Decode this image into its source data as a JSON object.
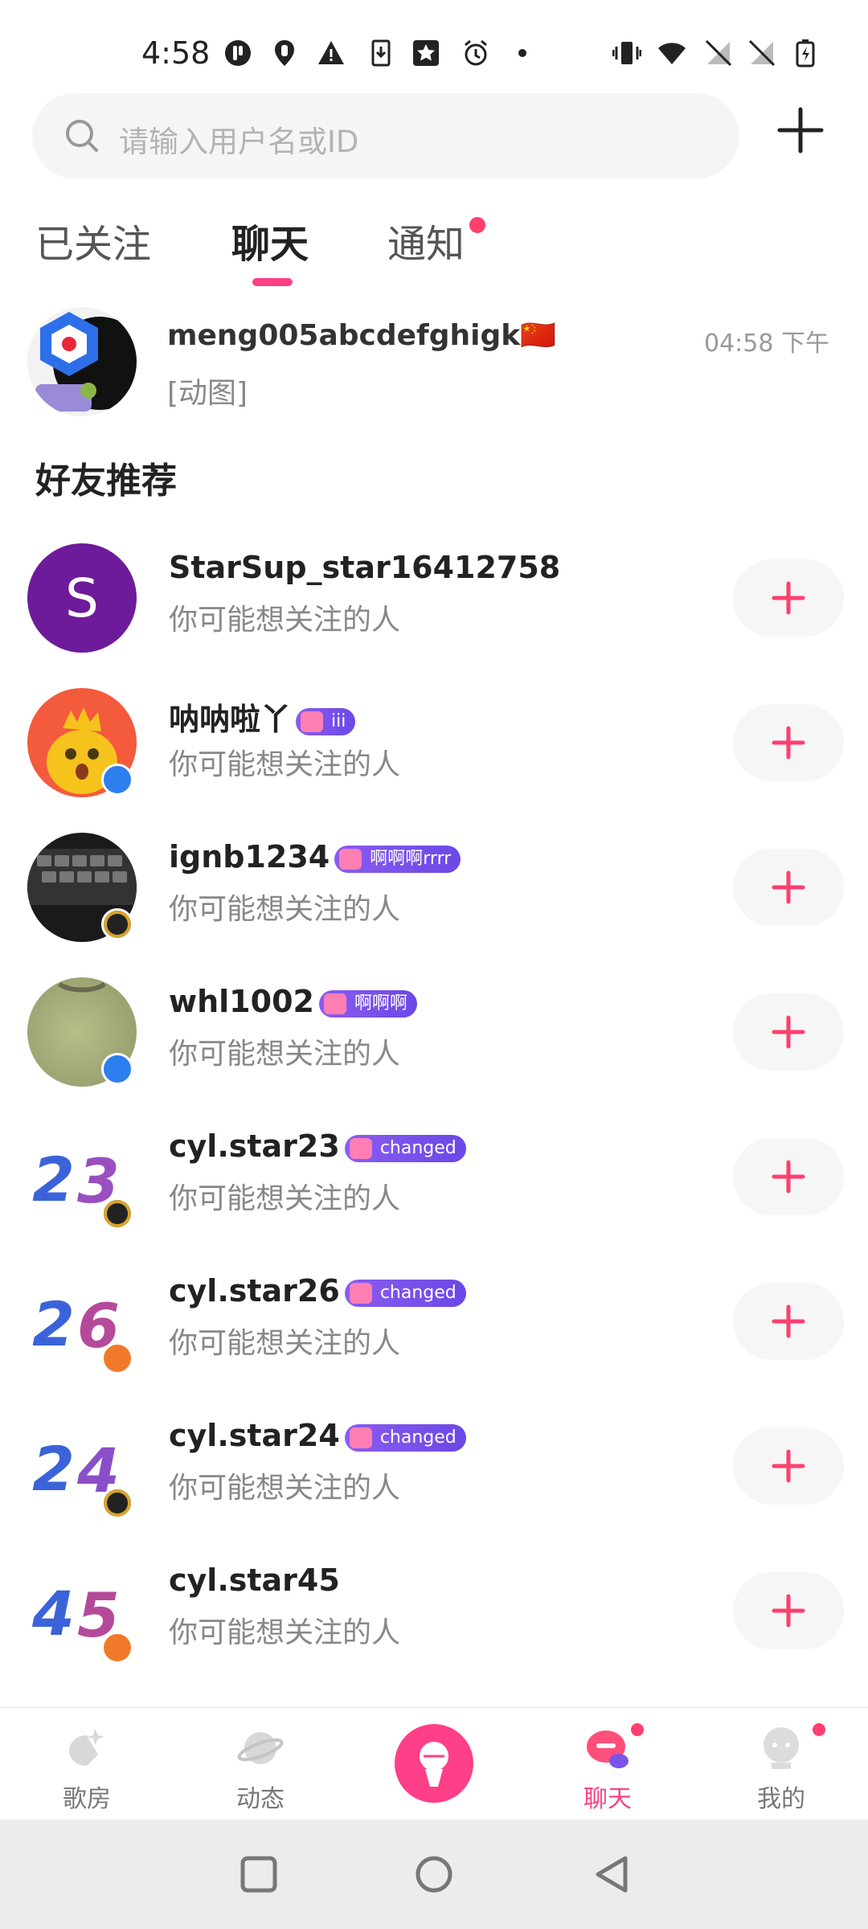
{
  "status_bar": {
    "time": "4:58"
  },
  "search": {
    "placeholder": "请输入用户名或ID"
  },
  "tabs": [
    {
      "label": "已关注"
    },
    {
      "label": "聊天"
    },
    {
      "label": "通知"
    }
  ],
  "chat": {
    "name": "meng005abcdefghigk🇨🇳",
    "last_message": "[动图]",
    "time": "04:58 下午"
  },
  "section_title": "好友推荐",
  "recommend": {
    "subtitle": "你可能想关注的人",
    "items": [
      {
        "name": "StarSup_star16412758",
        "tag": ""
      },
      {
        "name": "呐呐啦丫",
        "tag": "iii"
      },
      {
        "name": "ignb1234",
        "tag": "啊啊啊rrrr"
      },
      {
        "name": "whl1002",
        "tag": "啊啊啊"
      },
      {
        "name": "cyl.star23",
        "tag": "changed"
      },
      {
        "name": "cyl.star26",
        "tag": "changed"
      },
      {
        "name": "cyl.star24",
        "tag": "changed"
      },
      {
        "name": "cyl.star45",
        "tag": ""
      }
    ],
    "avatar_letter": "S"
  },
  "bottom_nav": [
    {
      "label": "歌房"
    },
    {
      "label": "动态"
    },
    {
      "label": ""
    },
    {
      "label": "聊天"
    },
    {
      "label": "我的"
    }
  ],
  "colors": {
    "accent": "#ff3f87",
    "tag": "#7a52ea"
  }
}
